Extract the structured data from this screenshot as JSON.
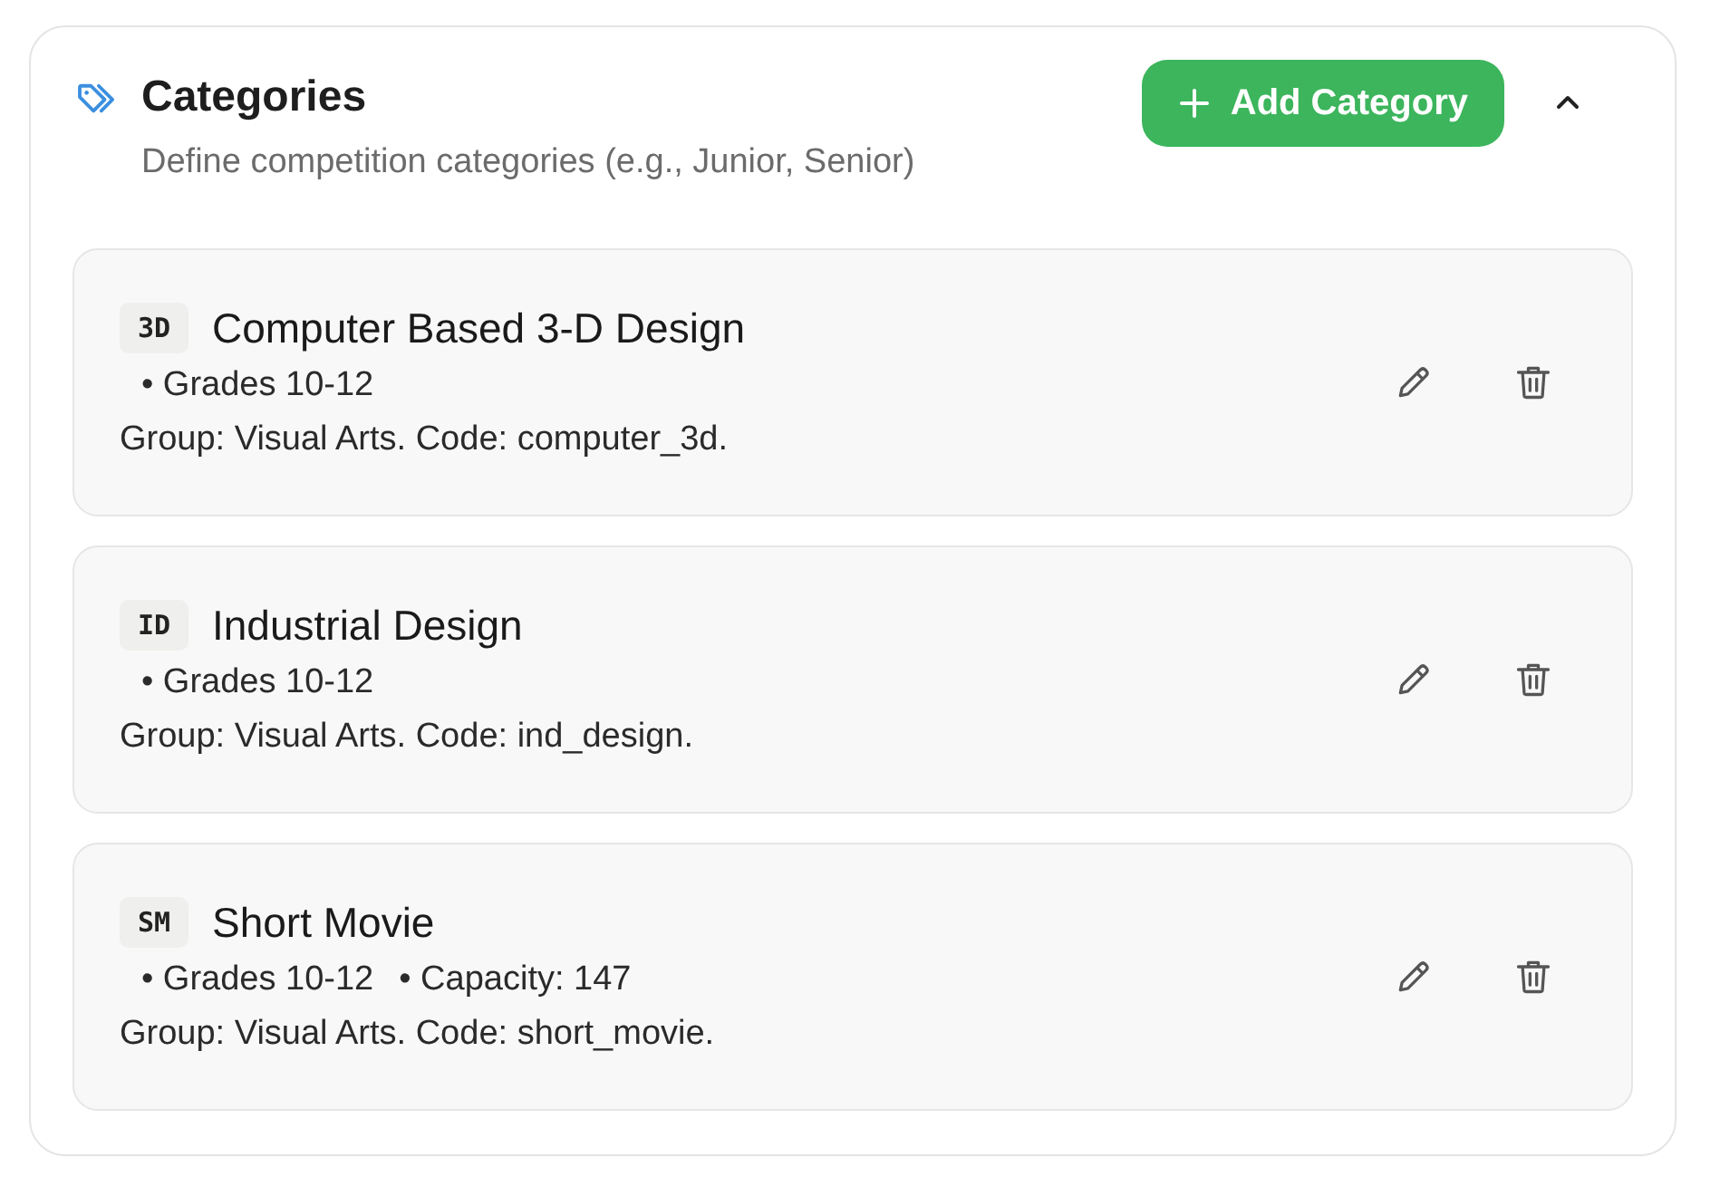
{
  "section": {
    "title": "Categories",
    "subtitle": "Define competition categories (e.g., Junior, Senior)",
    "add_button": {
      "label": "Add Category"
    },
    "expanded": true
  },
  "categories": [
    {
      "code": "3D",
      "name": "Computer Based 3-D Design",
      "details": [
        "• Grades 10-12"
      ],
      "description": "Group: Visual Arts. Code: computer_3d."
    },
    {
      "code": "ID",
      "name": "Industrial Design",
      "details": [
        "• Grades 10-12"
      ],
      "description": "Group: Visual Arts. Code: ind_design."
    },
    {
      "code": "SM",
      "name": "Short Movie",
      "details": [
        "• Grades 10-12",
        "• Capacity: 147"
      ],
      "description": "Group: Visual Arts. Code: short_movie."
    }
  ]
}
